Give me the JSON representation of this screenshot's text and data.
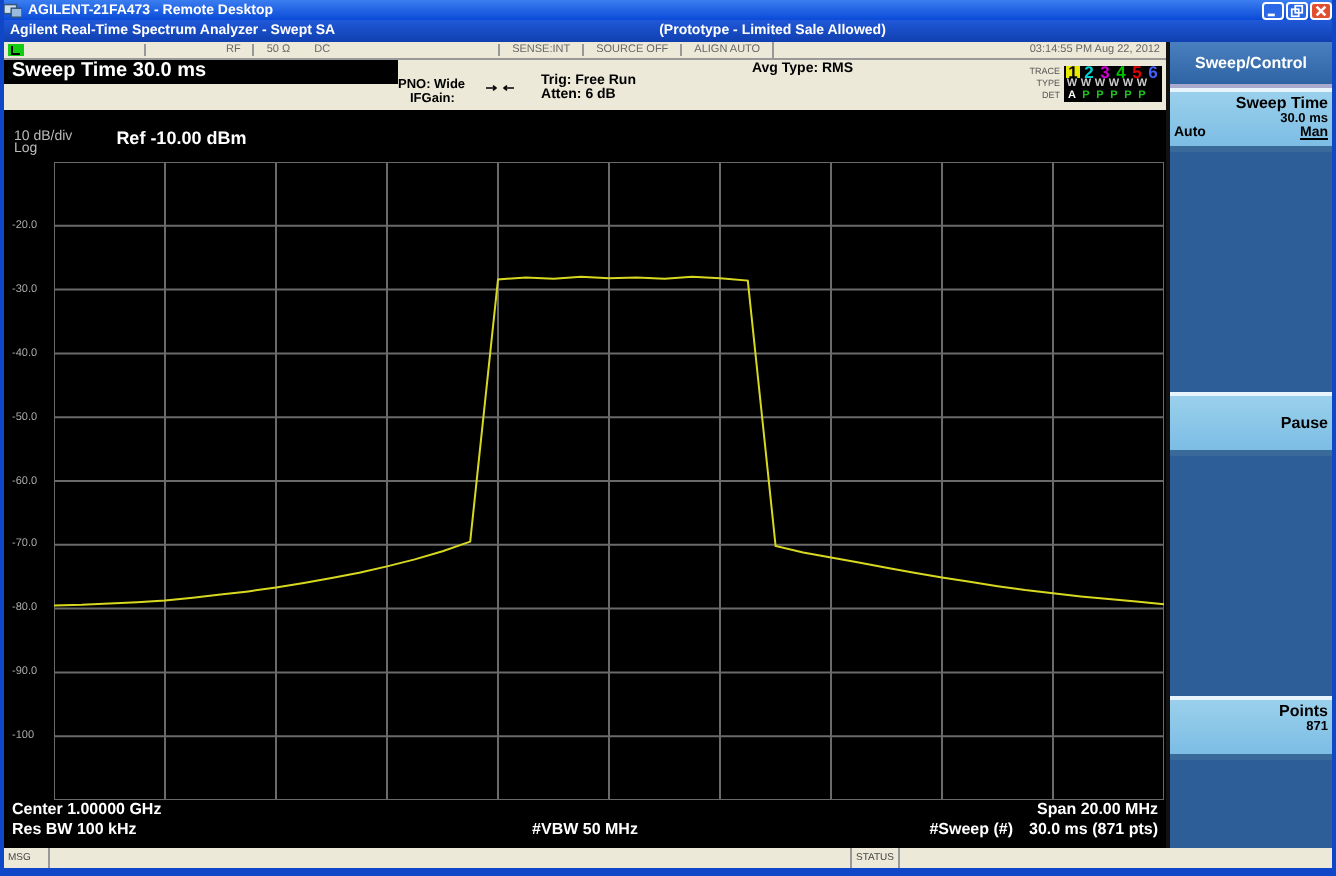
{
  "window": {
    "title": "AGILENT-21FA473 - Remote Desktop"
  },
  "app": {
    "title": "Agilent Real-Time Spectrum Analyzer - Swept SA",
    "notice": "(Prototype - Limited Sale Allowed)"
  },
  "status_row": {
    "cells": [
      "RF",
      "50 Ω",
      "DC",
      "SENSE:INT",
      "SOURCE OFF",
      "ALIGN AUTO"
    ],
    "datetime": "03:14:55 PM Aug 22, 2012"
  },
  "active_function": "Sweep Time 30.0 ms",
  "info": {
    "pno": "PNO: Wide",
    "ifgain": "IFGain:",
    "trig": "Trig: Free Run",
    "atten": "Atten: 6 dB",
    "avg": "Avg Type: RMS"
  },
  "traces": {
    "labels": [
      "TRACE",
      "TYPE",
      "DET"
    ],
    "items": [
      {
        "number": "1",
        "type": "W",
        "det": "A",
        "color": "#e8e800",
        "selected": true
      },
      {
        "number": "2",
        "type": "W",
        "det": "P",
        "color": "#00d0d0",
        "selected": false
      },
      {
        "number": "3",
        "type": "W",
        "det": "P",
        "color": "#d000d0",
        "selected": false
      },
      {
        "number": "4",
        "type": "W",
        "det": "P",
        "color": "#00c000",
        "selected": false
      },
      {
        "number": "5",
        "type": "W",
        "det": "P",
        "color": "#e00000",
        "selected": false
      },
      {
        "number": "6",
        "type": "W",
        "det": "P",
        "color": "#4060ff",
        "selected": false
      }
    ]
  },
  "plot": {
    "scale": "10 dB/div",
    "scale_type": "Log",
    "ref": "Ref -10.00 dBm",
    "chart_data": {
      "type": "line",
      "grid": true,
      "ylim": [
        -110,
        -10
      ],
      "yticks": [
        {
          "value": -20,
          "label": "-20.0"
        },
        {
          "value": -30,
          "label": "-30.0"
        },
        {
          "value": -40,
          "label": "-40.0"
        },
        {
          "value": -50,
          "label": "-50.0"
        },
        {
          "value": -60,
          "label": "-60.0"
        },
        {
          "value": -70,
          "label": "-70.0"
        },
        {
          "value": -80,
          "label": "-80.0"
        },
        {
          "value": -90,
          "label": "-90.0"
        },
        {
          "value": -100,
          "label": "-100"
        }
      ],
      "categories": [
        null,
        null,
        null,
        null,
        null,
        null,
        null,
        null,
        null,
        null,
        null,
        null,
        null,
        null,
        null,
        null,
        null,
        null,
        null,
        null,
        null,
        null,
        null,
        null,
        null,
        null,
        null,
        null,
        null,
        null,
        null,
        null,
        null,
        null,
        null,
        null,
        null,
        null,
        null,
        null,
        null
      ],
      "series": [
        {
          "color": "#d8d820",
          "values": [
            -79.5,
            -79.4,
            -79.2,
            -79.0,
            -78.7,
            -78.3,
            -77.8,
            -77.3,
            -76.7,
            -76.0,
            -75.2,
            -74.4,
            -73.4,
            -72.3,
            -71.0,
            -69.5,
            -28.4,
            -28.1,
            -28.3,
            -28.0,
            -28.2,
            -28.1,
            -28.3,
            -28.0,
            -28.2,
            -28.6,
            -70.2,
            -71.2,
            -72.0,
            -72.8,
            -73.6,
            -74.4,
            -75.1,
            -75.8,
            -76.5,
            -77.1,
            -77.6,
            -78.1,
            -78.5,
            -78.9,
            -79.3
          ]
        }
      ]
    },
    "center": "Center 1.00000 GHz",
    "res_bw": "Res BW 100 kHz",
    "vbw": "#VBW 50 MHz",
    "span": "Span 20.00 MHz",
    "sweep_label": "#Sweep (#)",
    "sweep": "30.0 ms (871 pts)"
  },
  "softkeys": {
    "title": "Sweep/Control",
    "keys": [
      {
        "kind": "toggle",
        "label": "Sweep Time",
        "value": "30.0 ms",
        "option_a": "Auto",
        "option_b": "Man",
        "man_selected": true
      },
      {
        "kind": "blank"
      },
      {
        "kind": "action",
        "label": "Pause"
      },
      {
        "kind": "blank"
      },
      {
        "kind": "value",
        "label": "Points",
        "value": "871"
      }
    ]
  },
  "status_bar": {
    "msg": "MSG",
    "status": "STATUS"
  }
}
